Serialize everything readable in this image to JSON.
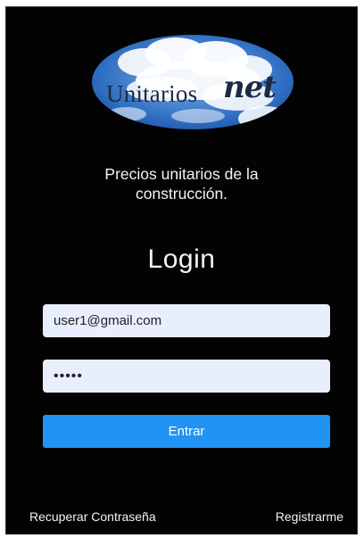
{
  "logo": {
    "text": "Unitarios",
    "suffix": "net"
  },
  "tagline": {
    "line1": "Precios unitarios de la",
    "line2": "construcción."
  },
  "login": {
    "title": "Login",
    "email_value": "user1@gmail.com",
    "password_value": "•••••",
    "submit_label": "Entrar"
  },
  "footer": {
    "recover_label": "Recuperar Contraseña",
    "register_label": "Registrarme"
  },
  "colors": {
    "background": "#030303",
    "input_background": "#e8eefc",
    "button": "#2193f2",
    "text": "#f2f2f2"
  }
}
